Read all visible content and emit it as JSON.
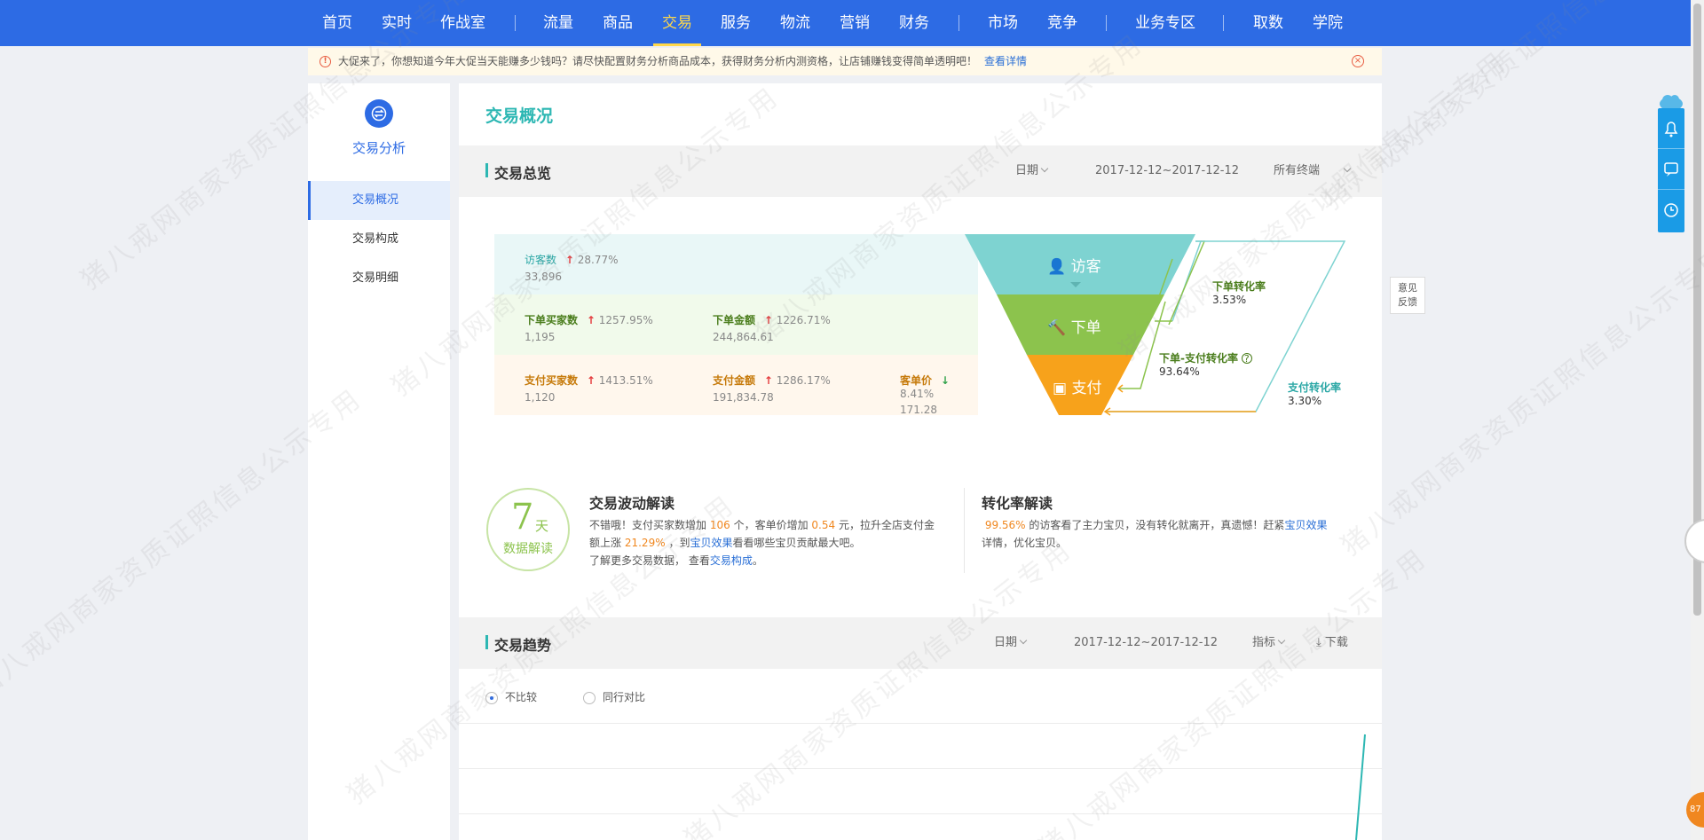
{
  "nav": {
    "items": [
      "首页",
      "实时",
      "作战室",
      "流量",
      "商品",
      "交易",
      "服务",
      "物流",
      "营销",
      "财务",
      "市场",
      "竞争",
      "业务专区",
      "取数",
      "学院"
    ],
    "active": "交易"
  },
  "notice": {
    "text": "大促来了，你想知道今年大促当天能赚多少钱吗？请尽快配置财务分析商品成本，获得财务分析内测资格，让店铺赚钱变得简单透明吧！",
    "link": "查看详情"
  },
  "sidebar": {
    "title": "交易分析",
    "items": [
      "交易概况",
      "交易构成",
      "交易明细"
    ],
    "active": "交易概况"
  },
  "page_title": "交易概况",
  "overview": {
    "title": "交易总览",
    "date_select": "日期",
    "date_range": "2017-12-12~2017-12-12",
    "terminal": "所有终端",
    "visitors": {
      "label": "访客数",
      "pct": "28.77%",
      "value": "33,896",
      "trend": "up"
    },
    "order_buyers": {
      "label": "下单买家数",
      "pct": "1257.95%",
      "value": "1,195",
      "trend": "up"
    },
    "order_amount": {
      "label": "下单金额",
      "pct": "1226.71%",
      "value": "244,864.61",
      "trend": "up"
    },
    "pay_buyers": {
      "label": "支付买家数",
      "pct": "1413.51%",
      "value": "1,120",
      "trend": "up"
    },
    "pay_amount": {
      "label": "支付金额",
      "pct": "1286.17%",
      "value": "191,834.78",
      "trend": "up"
    },
    "unit_price": {
      "label": "客单价",
      "pct": "8.41%",
      "value": "171.28",
      "trend": "down"
    },
    "funnel": {
      "visit": "访客",
      "order": "下单",
      "pay": "支付"
    },
    "rates": {
      "order_rate": {
        "label": "下单转化率",
        "value": "3.53%"
      },
      "order_pay_rate": {
        "label": "下单-支付转化率",
        "value": "93.64%"
      },
      "pay_rate": {
        "label": "支付转化率",
        "value": "3.30%"
      }
    },
    "colors": {
      "visit": "#7ed3d1",
      "order": "#8cc34d",
      "pay": "#f7a21b"
    }
  },
  "analysis": {
    "badge": {
      "num": "7",
      "unit": "天",
      "sub": "数据解读"
    },
    "fluct_title": "交易波动解读",
    "fluct": {
      "p1": "不错哦！支付买家数增加",
      "n1": "106",
      "p2": "个，客单价增加",
      "n2": "0.54",
      "p3": "元，拉升全店支付金额上涨",
      "n3": "21.29%",
      "p4": "，到",
      "l1": "宝贝效果",
      "p5": "看看哪些宝贝贡献最大吧。",
      "p6": "了解更多交易数据，  查看",
      "l2": "交易构成",
      "p7": "。"
    },
    "conv_title": "转化率解读",
    "conv": {
      "n1": "99.56%",
      "p1": "的访客看了主力宝贝，没有转化就离开，真遗憾！赶紧",
      "l1": "宝贝效果",
      "p2": "详情，优化宝贝。"
    }
  },
  "trend": {
    "title": "交易趋势",
    "date_select": "日期",
    "date_range": "2017-12-12~2017-12-12",
    "metric": "指标",
    "download": "下载",
    "radio1": "不比较",
    "radio2": "同行对比"
  },
  "feedback": [
    "意见",
    "反馈"
  ],
  "edge_badge": "87",
  "watermark": "猪八戒网商家资质证照信息公示专用"
}
